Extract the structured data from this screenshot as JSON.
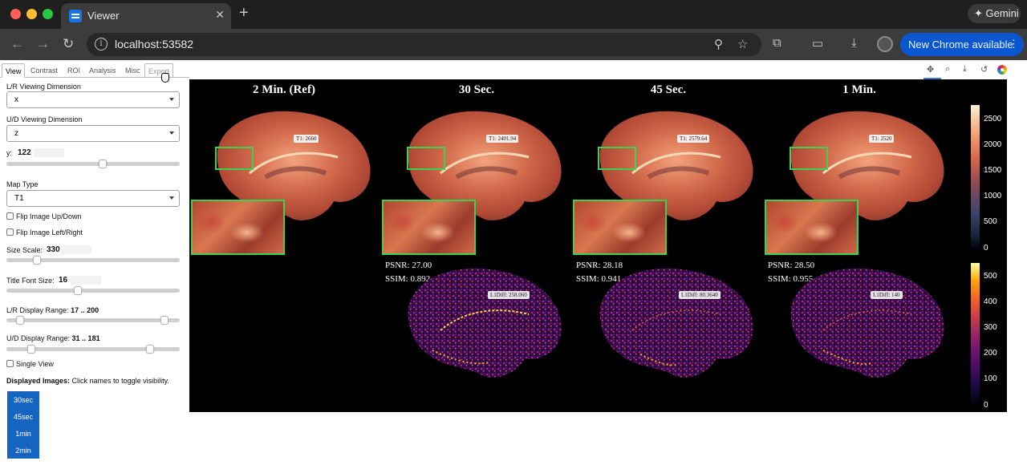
{
  "browser": {
    "tab_title": "Viewer",
    "tab_close": "✕",
    "new_tab": "+",
    "gemini_label": "✦ Gemini",
    "url": "localhost:53582",
    "update_label": "New Chrome available",
    "update_menu": "⋮"
  },
  "app": {
    "tabs": [
      "View",
      "Contrast",
      "ROI",
      "Analysis",
      "Misc",
      "Export"
    ],
    "active_tab": "View"
  },
  "controls": {
    "lr_dim_label": "L/R Viewing Dimension",
    "lr_dim_value": "x",
    "ud_dim_label": "U/D Viewing Dimension",
    "ud_dim_value": "z",
    "y_label": "y:",
    "y_value": "122",
    "y_fraction": 0.56,
    "map_type_label": "Map Type",
    "map_type_value": "T1",
    "flip_ud_label": "Flip Image Up/Down",
    "flip_lr_label": "Flip Image Left/Right",
    "size_scale_label": "Size Scale:",
    "size_scale_value": "330",
    "size_scale_fraction": 0.16,
    "title_font_label": "Title Font Size:",
    "title_font_value": "16",
    "title_font_fraction": 0.41,
    "lr_range_label": "L/R Display Range:",
    "lr_range_value": "17 .. 200",
    "ud_range_label": "U/D Display Range:",
    "ud_range_value": "31 .. 181",
    "single_view_label": "Single View",
    "displayed_images_label": "Displayed Images:",
    "displayed_images_hint": "Click names to toggle visibility.",
    "image_buttons": [
      "30sec",
      "45sec",
      "1min",
      "2min"
    ]
  },
  "viewer": {
    "columns": [
      {
        "title": "2 Min. (Ref)",
        "t1_tag": "T1: 2660"
      },
      {
        "title": "30 Sec.",
        "t1_tag": "T1: 2401.94",
        "psnr": "PSNR: 27.00",
        "ssim": "SSIM: 0.892",
        "diff_tag": "L1Diff: 258.060"
      },
      {
        "title": "45 Sec.",
        "t1_tag": "T1: 2579.64",
        "psnr": "PSNR: 28.18",
        "ssim": "SSIM: 0.941",
        "diff_tag": "L1Diff: 80.3640"
      },
      {
        "title": "1 Min.",
        "t1_tag": "T1: 2520",
        "psnr": "PSNR: 28.50",
        "ssim": "SSIM: 0.955",
        "diff_tag": "L1Diff: 140"
      }
    ],
    "t1_colorbar_ticks": [
      "2500",
      "2000",
      "1500",
      "1000",
      "500",
      "0"
    ],
    "diff_colorbar_ticks": [
      "500",
      "400",
      "300",
      "200",
      "100",
      "0"
    ],
    "colors": {
      "roi_box": "#3ad24f",
      "button_blue": "#1565c0"
    }
  }
}
